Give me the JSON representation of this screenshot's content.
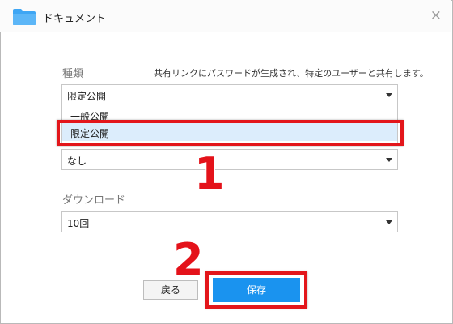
{
  "window": {
    "title": "ドキュメント",
    "folder_icon": "folder-icon",
    "close_icon": "close-icon",
    "close_glyph": "×"
  },
  "type_field": {
    "label": "種類",
    "description": "共有リンクにパスワードが生成され、特定のユーザーと共有します。",
    "selected": "限定公開",
    "options": [
      "一般公開",
      "限定公開"
    ],
    "highlighted_option": "限定公開"
  },
  "expiry_field": {
    "selected": "なし"
  },
  "download_field": {
    "label": "ダウンロード",
    "selected": "10回"
  },
  "buttons": {
    "back": "戻る",
    "save": "保存"
  },
  "annotations": {
    "step1": "1",
    "step2": "2",
    "color": "#e3161b"
  },
  "colors": {
    "accent": "#1a93ef",
    "selected_option_bg": "#dcedfc",
    "folder": "#3ea6f4"
  }
}
